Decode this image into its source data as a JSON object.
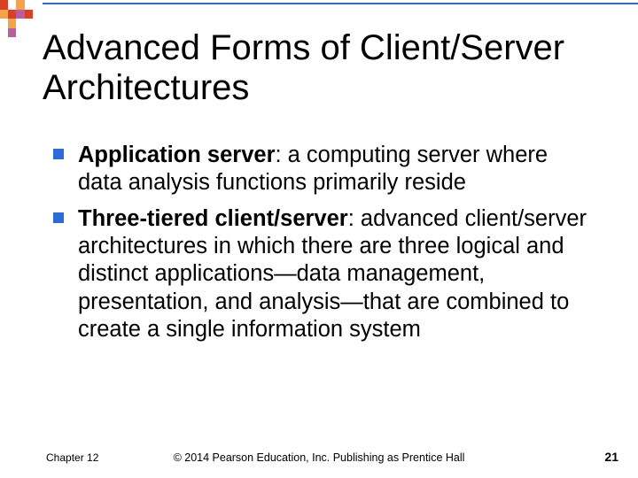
{
  "title": "Advanced Forms of Client/Server Architectures",
  "bullets": [
    {
      "bold": "Application server",
      "rest": ": a computing server where data analysis functions primarily reside"
    },
    {
      "bold": "Three-tiered client/server",
      "rest": ": advanced client/server architectures in which there are three logical and distinct applications—data management, presentation, and analysis—that are combined to create a single information system"
    }
  ],
  "footer": {
    "left": "Chapter 12",
    "center": "© 2014 Pearson Education, Inc. Publishing as Prentice Hall",
    "right": "21"
  }
}
